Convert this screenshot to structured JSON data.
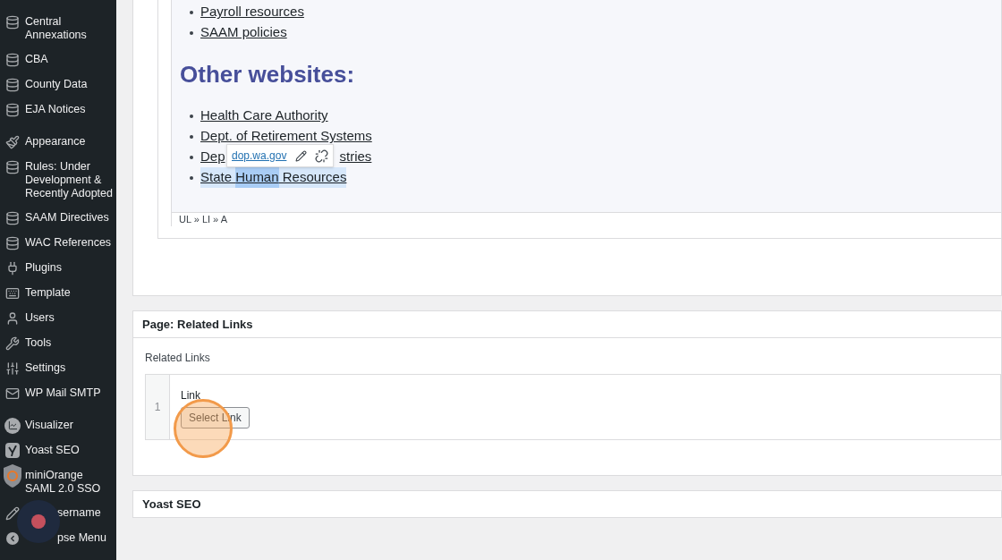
{
  "sidebar": {
    "sections": [
      {
        "items": [
          {
            "label": "Central Annexations"
          },
          {
            "label": "CBA"
          },
          {
            "label": "County Data"
          },
          {
            "label": "EJA Notices"
          }
        ]
      },
      {
        "items": [
          {
            "label": "Appearance"
          },
          {
            "label": "Rules: Under Development & Recently Adopted"
          },
          {
            "label": "SAAM Directives"
          },
          {
            "label": "WAC References"
          },
          {
            "label": "Plugins"
          },
          {
            "label": "Template"
          },
          {
            "label": "Users"
          },
          {
            "label": "Tools"
          },
          {
            "label": "Settings"
          },
          {
            "label": "WP Mail SMTP"
          }
        ]
      },
      {
        "items": [
          {
            "label": "Visualizer"
          },
          {
            "label": "Yoast SEO"
          },
          {
            "label": "miniOrange SAML 2.0 SSO"
          },
          {
            "label": "sername"
          },
          {
            "label": "pse Menu"
          }
        ]
      }
    ]
  },
  "editor": {
    "top_links": [
      "Payroll resources",
      "SAAM policies"
    ],
    "heading": "Other websites:",
    "links": [
      {
        "selected": false,
        "segments": [
          {
            "text": "Health Care Authority"
          }
        ]
      },
      {
        "selected": false,
        "segments": [
          {
            "text": "Dept. of Retirement Systems"
          }
        ]
      },
      {
        "selected": false,
        "segments": [
          {
            "text": "Dep"
          },
          {
            "text": "stries"
          }
        ]
      },
      {
        "selected": true,
        "segments": [
          {
            "text": "State ",
            "focused": false
          },
          {
            "text": "Human",
            "focused": true
          },
          {
            "text": " Resources",
            "focused": false
          }
        ]
      }
    ],
    "link_popup": {
      "url": "dop.wa.gov"
    },
    "path": "UL » LI » A"
  },
  "related_links": {
    "title": "Page: Related Links",
    "field_label": "Related Links",
    "rows": [
      {
        "index": "1",
        "label": "Link",
        "button": "Select Link"
      }
    ]
  },
  "yoast": {
    "title": "Yoast SEO"
  }
}
